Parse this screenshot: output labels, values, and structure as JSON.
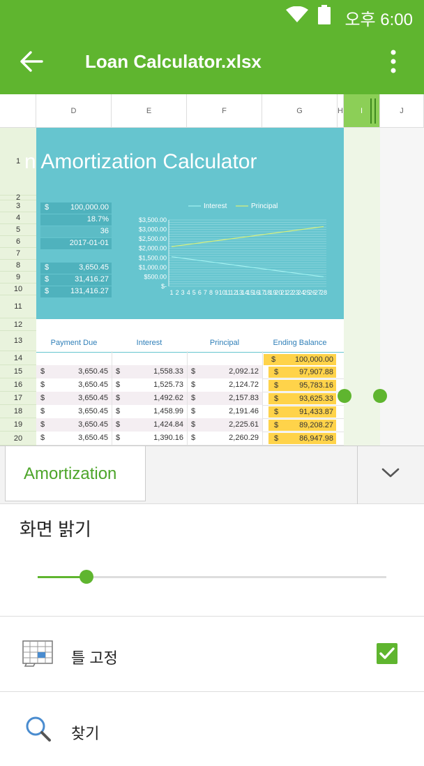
{
  "status": {
    "time": "오후 6:00"
  },
  "appbar": {
    "title": "Loan Calculator.xlsx"
  },
  "sheet": {
    "columns": [
      "D",
      "E",
      "F",
      "G",
      "H",
      "I",
      "J"
    ],
    "rows": [
      "1",
      "2",
      "3",
      "4",
      "5",
      "6",
      "7",
      "8",
      "9",
      "10",
      "11",
      "12",
      "13",
      "14",
      "15",
      "16",
      "17",
      "18",
      "19",
      "20"
    ],
    "title": "n Amortization Calculator",
    "values": [
      {
        "dollar": "$",
        "value": "100,000.00"
      },
      {
        "dollar": "",
        "value": "18.7%"
      },
      {
        "dollar": "",
        "value": "36"
      },
      {
        "dollar": "",
        "value": "2017-01-01"
      },
      {
        "dollar": "$",
        "value": "3,650.45"
      },
      {
        "dollar": "$",
        "value": "31,416.27"
      },
      {
        "dollar": "$",
        "value": "131,416.27"
      }
    ],
    "table_headers": [
      "Payment Due",
      "Interest",
      "Principal",
      "Ending Balance"
    ],
    "first_balance": {
      "dollar": "$",
      "value": "100,000.00"
    },
    "table_rows": [
      {
        "payment": "3,650.45",
        "interest": "1,558.33",
        "principal": "2,092.12",
        "balance": "97,907.88"
      },
      {
        "payment": "3,650.45",
        "interest": "1,525.73",
        "principal": "2,124.72",
        "balance": "95,783.16"
      },
      {
        "payment": "3,650.45",
        "interest": "1,492.62",
        "principal": "2,157.83",
        "balance": "93,625.33"
      },
      {
        "payment": "3,650.45",
        "interest": "1,458.99",
        "principal": "2,191.46",
        "balance": "91,433.87"
      },
      {
        "payment": "3,650.45",
        "interest": "1,424.84",
        "principal": "2,225.61",
        "balance": "89,208.27"
      },
      {
        "payment": "3,650.45",
        "interest": "1,390.16",
        "principal": "2,260.29",
        "balance": "86,947.98"
      }
    ],
    "dollar_sign": "$"
  },
  "chart_data": {
    "type": "line",
    "legend": [
      "Interest",
      "Principal"
    ],
    "legend_position": "top",
    "y_ticks": [
      "$3,500.00",
      "$3,000.00",
      "$2,500.00",
      "$2,000.00",
      "$1,500.00",
      "$1,000.00",
      "$500.00",
      "$-"
    ],
    "x": [
      1,
      2,
      3,
      4,
      5,
      6,
      7,
      8,
      9,
      10,
      11,
      12,
      13,
      14,
      15,
      16,
      17,
      18,
      19,
      20,
      21,
      22,
      23,
      24,
      25,
      26,
      27,
      28
    ],
    "series": [
      {
        "name": "Interest",
        "color": "#9ff0f0",
        "start": 1558.33,
        "end": 500
      },
      {
        "name": "Principal",
        "color": "#d9f07a",
        "start": 2092.12,
        "end": 3150
      }
    ],
    "ylim": [
      0,
      3500
    ],
    "grid": true
  },
  "tabs": {
    "active": "Amortization"
  },
  "brightness": {
    "title": "화면 밝기",
    "level": 0.14
  },
  "menu": {
    "freeze": "틀 고정",
    "freeze_checked": true,
    "find": "찾기"
  },
  "colors": {
    "accent": "#5fb52f",
    "banner": "#66c5cf",
    "balance": "#ffd34a"
  }
}
